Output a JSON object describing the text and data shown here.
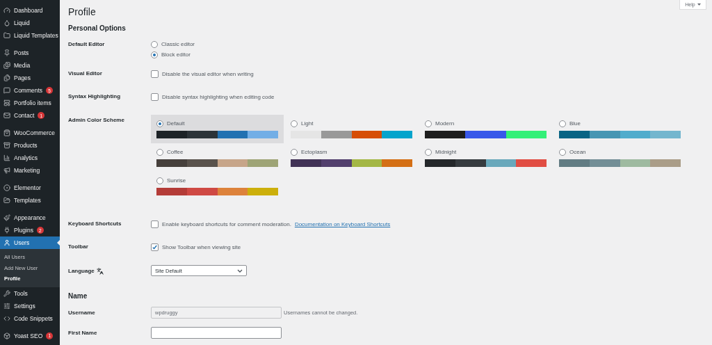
{
  "sidebar": {
    "groups": [
      {
        "items": [
          {
            "label": "Dashboard",
            "selected": false
          },
          {
            "label": "Liquid",
            "selected": false
          },
          {
            "label": "Liquid Templates",
            "selected": false
          }
        ]
      },
      {
        "items": [
          {
            "label": "Posts",
            "selected": false
          },
          {
            "label": "Media",
            "selected": false
          },
          {
            "label": "Pages",
            "selected": false
          },
          {
            "label": "Comments",
            "badge": "5",
            "selected": false
          },
          {
            "label": "Portfolio items",
            "selected": false
          },
          {
            "label": "Contact",
            "badge": "1",
            "selected": false
          }
        ]
      },
      {
        "items": [
          {
            "label": "WooCommerce",
            "selected": false
          },
          {
            "label": "Products",
            "selected": false
          },
          {
            "label": "Analytics",
            "selected": false
          },
          {
            "label": "Marketing",
            "selected": false
          }
        ]
      },
      {
        "items": [
          {
            "label": "Elementor",
            "selected": false
          },
          {
            "label": "Templates",
            "selected": false
          }
        ]
      },
      {
        "items": [
          {
            "label": "Appearance",
            "selected": false
          },
          {
            "label": "Plugins",
            "badge": "2",
            "selected": false
          },
          {
            "label": "Users",
            "selected": true,
            "children": [
              {
                "label": "All Users",
                "selected": false
              },
              {
                "label": "Add New User",
                "selected": false
              },
              {
                "label": "Profile",
                "selected": true
              }
            ]
          },
          {
            "label": "Tools",
            "selected": false
          },
          {
            "label": "Settings",
            "selected": false
          },
          {
            "label": "Code Snippets",
            "selected": false
          }
        ]
      },
      {
        "items": [
          {
            "label": "Yoast SEO",
            "badge": "1",
            "selected": false
          }
        ]
      }
    ]
  },
  "help_button": {
    "label": "Help"
  },
  "title": "Profile",
  "sections": [
    {
      "heading": "Personal Options",
      "rows": [
        {
          "kind": "radios",
          "label": "Default Editor",
          "options": [
            {
              "label": "Classic editor",
              "selected": false
            },
            {
              "label": "Block editor",
              "selected": true
            }
          ]
        },
        {
          "kind": "checkbox",
          "label": "Visual Editor",
          "text": "Disable the visual editor when writing",
          "checked": false
        },
        {
          "kind": "checkbox",
          "label": "Syntax Highlighting",
          "text": "Disable syntax highlighting when editing code",
          "checked": false
        },
        {
          "kind": "schemes",
          "label": "Admin Color Scheme",
          "schemes": [
            {
              "name": "Default",
              "selected": true,
              "swatches": [
                {
                  "color": "#1d2327"
                },
                {
                  "color": "#2c3338"
                },
                {
                  "color": "#2271b1"
                },
                {
                  "color": "#72aee6"
                }
              ]
            },
            {
              "name": "Light",
              "selected": false,
              "swatches": [
                {
                  "color": "#e5e5e5"
                },
                {
                  "color": "#999999"
                },
                {
                  "color": "#d64e07"
                },
                {
                  "color": "#04a4cc"
                }
              ]
            },
            {
              "name": "Modern",
              "selected": false,
              "swatches": [
                {
                  "color": "#1e1e1e"
                },
                {
                  "color": "#3858e9"
                },
                {
                  "color": "#33f078"
                }
              ]
            },
            {
              "name": "Blue",
              "selected": false,
              "swatches": [
                {
                  "color": "#096484"
                },
                {
                  "color": "#4796b3"
                },
                {
                  "color": "#52accc"
                },
                {
                  "color": "#74b6ce"
                }
              ]
            },
            {
              "name": "Coffee",
              "selected": false,
              "swatches": [
                {
                  "color": "#46403c"
                },
                {
                  "color": "#59524c"
                },
                {
                  "color": "#c7a589"
                },
                {
                  "color": "#9ea476"
                }
              ]
            },
            {
              "name": "Ectoplasm",
              "selected": false,
              "swatches": [
                {
                  "color": "#413256"
                },
                {
                  "color": "#523f6d"
                },
                {
                  "color": "#a3b745"
                },
                {
                  "color": "#d46f15"
                }
              ]
            },
            {
              "name": "Midnight",
              "selected": false,
              "swatches": [
                {
                  "color": "#25282b"
                },
                {
                  "color": "#363b3f"
                },
                {
                  "color": "#69a8bb"
                },
                {
                  "color": "#e14d43"
                }
              ]
            },
            {
              "name": "Ocean",
              "selected": false,
              "swatches": [
                {
                  "color": "#627c83"
                },
                {
                  "color": "#738e96"
                },
                {
                  "color": "#9ebaa0"
                },
                {
                  "color": "#aa9d88"
                }
              ]
            },
            {
              "name": "Sunrise",
              "selected": false,
              "swatches": [
                {
                  "color": "#b43c38"
                },
                {
                  "color": "#cf4944"
                },
                {
                  "color": "#dd823b"
                },
                {
                  "color": "#ccaf0b"
                }
              ]
            }
          ]
        },
        {
          "kind": "checkbox",
          "label": "Keyboard Shortcuts",
          "text": "Enable keyboard shortcuts for comment moderation.",
          "link": "Documentation on Keyboard Shortcuts",
          "checked": false
        },
        {
          "kind": "checkbox",
          "label": "Toolbar",
          "text": "Show Toolbar when viewing site",
          "checked": true
        },
        {
          "kind": "select",
          "label": "Language",
          "value": "Site Default"
        }
      ]
    },
    {
      "heading": "Name",
      "rows": [
        {
          "kind": "text",
          "label": "Username",
          "value": "wpdruggy",
          "disabled": true,
          "note": "Usernames cannot be changed."
        },
        {
          "kind": "text",
          "label": "First Name",
          "disabled": false
        }
      ]
    }
  ]
}
